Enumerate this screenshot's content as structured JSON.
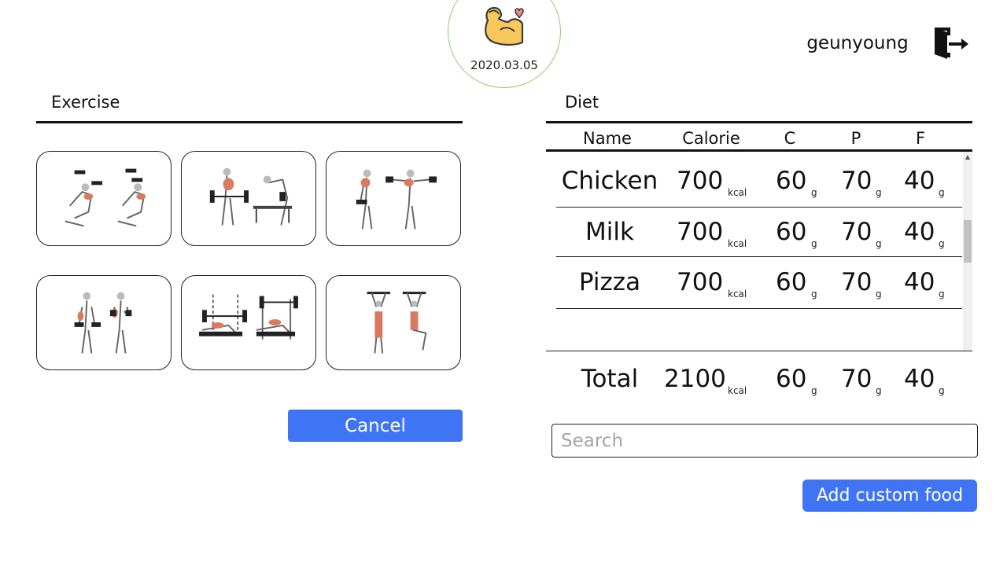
{
  "header": {
    "date": "2020.03.05",
    "username": "geunyoung",
    "logo_icon": "flexed-arm-heart-icon",
    "logout_icon": "logout-door-icon"
  },
  "exercise": {
    "title": "Exercise",
    "cards": [
      {
        "name": "incline-dumbbell-fly",
        "icon": "exercise-image"
      },
      {
        "name": "barbell-row",
        "icon": "exercise-image"
      },
      {
        "name": "dumbbell-lateral-raise",
        "icon": "exercise-image"
      },
      {
        "name": "dumbbell-curl",
        "icon": "exercise-image"
      },
      {
        "name": "bench-press",
        "icon": "exercise-image"
      },
      {
        "name": "hanging-leg-raise",
        "icon": "exercise-image"
      }
    ],
    "cancel_label": "Cancel"
  },
  "diet": {
    "title": "Diet",
    "columns": [
      "Name",
      "Calorie",
      "C",
      "P",
      "F"
    ],
    "kcal_unit": "kcal",
    "g_unit": "g",
    "rows": [
      {
        "name": "Chicken",
        "calorie": "700",
        "c": "60",
        "p": "70",
        "f": "40"
      },
      {
        "name": "Milk",
        "calorie": "700",
        "c": "60",
        "p": "70",
        "f": "40"
      },
      {
        "name": "Pizza",
        "calorie": "700",
        "c": "60",
        "p": "70",
        "f": "40"
      }
    ],
    "total": {
      "name": "Total",
      "calorie": "2100",
      "c": "60",
      "p": "70",
      "f": "40"
    },
    "search_placeholder": "Search",
    "add_custom_label": "Add custom food",
    "colors": {
      "accent": "#3f74f4",
      "logo_ring": "#8bcf6a",
      "arm": "#f8c85c",
      "heart": "#f08a8a"
    }
  }
}
